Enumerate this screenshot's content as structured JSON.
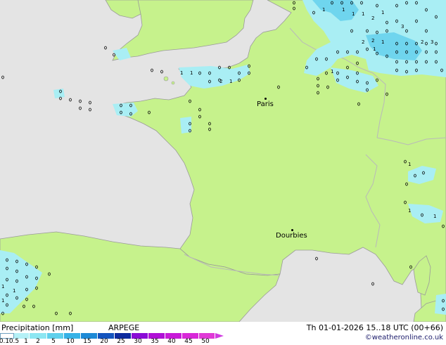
{
  "map": {
    "cities": [
      {
        "name": "Paris"
      },
      {
        "name": "Dourbies"
      }
    ],
    "colors": {
      "land": "#c6f28c",
      "sea": "#e4e4e4",
      "precip_light": "#a9eef4",
      "precip_medium": "#6fd5ee",
      "border": "#b9b9b9",
      "coast": "#9a9a9a"
    }
  },
  "legend": {
    "title": "Precipitation [mm]",
    "model": "ARPEGE",
    "run_time": "Th 01-01-2026 15..18 UTC (00+66)",
    "credit": "©weatheronline.co.uk",
    "labels": [
      "0.1",
      "0.5",
      "1",
      "2",
      "5",
      "10",
      "15",
      "20",
      "25",
      "30",
      "35",
      "40",
      "45",
      "50"
    ],
    "colors": [
      "#ffffff",
      "#dff9fb",
      "#b4f0f6",
      "#8ce6f2",
      "#5fd0ec",
      "#36b2e6",
      "#1e8ad6",
      "#1454be",
      "#0d2a9e",
      "#8a0ad6",
      "#b010d6",
      "#c81ad8",
      "#d828d8",
      "#e03ad6"
    ]
  }
}
